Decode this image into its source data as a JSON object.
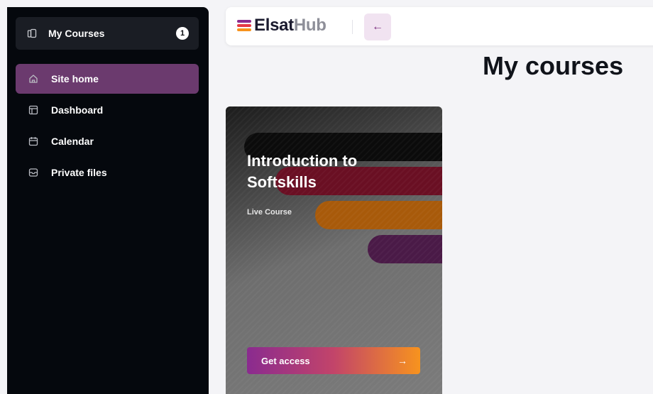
{
  "sidebar": {
    "my_courses": {
      "label": "My Courses",
      "count": "1",
      "icon": "courses-icon"
    },
    "items": [
      {
        "label": "Site home",
        "icon": "home-icon",
        "active": true
      },
      {
        "label": "Dashboard",
        "icon": "dashboard-icon",
        "active": false
      },
      {
        "label": "Calendar",
        "icon": "calendar-icon",
        "active": false
      },
      {
        "label": "Private files",
        "icon": "folder-icon",
        "active": false
      }
    ]
  },
  "header": {
    "brand_part1": "Elsat",
    "brand_part2": "Hub",
    "back_icon": "arrow-left-icon"
  },
  "main": {
    "title": "My courses",
    "courses": [
      {
        "title": "Introduction to Softskills",
        "subtitle": "Live Course",
        "action_label": "Get access",
        "action_icon": "arrow-right-icon"
      }
    ]
  },
  "colors": {
    "sidebar_bg": "#05080d",
    "active_item": "#6b3a6e",
    "accent_purple": "#8a2b8f",
    "accent_orange": "#f7931e",
    "logo_stripes": [
      "#8a2b8f",
      "#e63946",
      "#f7931e"
    ]
  }
}
